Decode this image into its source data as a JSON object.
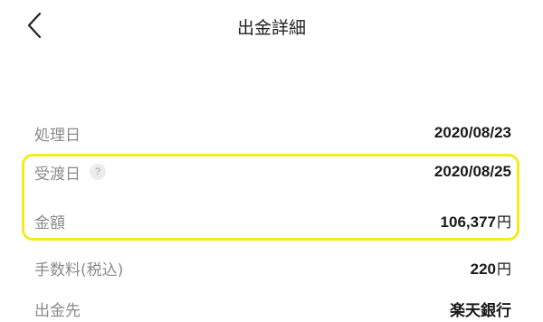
{
  "header": {
    "title": "出金詳細",
    "back_icon": "chevron-left-icon"
  },
  "details": {
    "processed_date": {
      "label": "処理日",
      "value": "2020/08/23"
    },
    "received_date": {
      "label": "受渡日",
      "value": "2020/08/25",
      "help_symbol": "?"
    },
    "amount": {
      "label": "金額",
      "value": "106,377",
      "unit": "円"
    },
    "fee": {
      "label": "手数料(税込)",
      "value": "220",
      "unit": "円"
    },
    "destination": {
      "label": "出金先",
      "value": "楽天銀行"
    }
  },
  "colors": {
    "highlight": "#f2ec1c",
    "label": "#8a8a8a",
    "value": "#1a1a1a"
  }
}
